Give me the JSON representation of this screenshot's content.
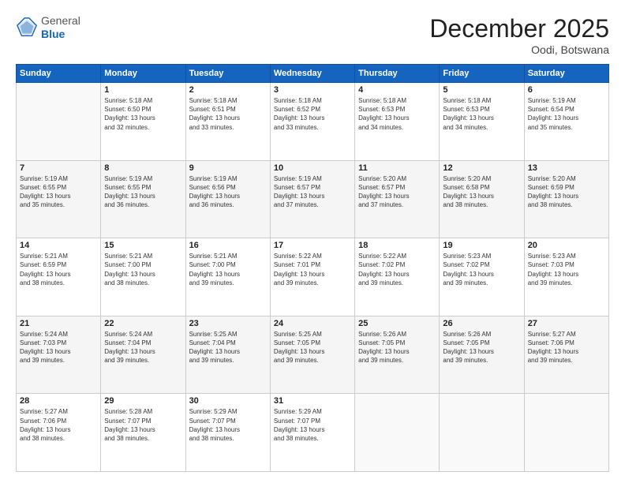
{
  "header": {
    "logo_line1": "General",
    "logo_line2": "Blue",
    "month_year": "December 2025",
    "location": "Oodi, Botswana"
  },
  "days_of_week": [
    "Sunday",
    "Monday",
    "Tuesday",
    "Wednesday",
    "Thursday",
    "Friday",
    "Saturday"
  ],
  "weeks": [
    [
      {
        "day": "",
        "info": ""
      },
      {
        "day": "1",
        "info": "Sunrise: 5:18 AM\nSunset: 6:50 PM\nDaylight: 13 hours\nand 32 minutes."
      },
      {
        "day": "2",
        "info": "Sunrise: 5:18 AM\nSunset: 6:51 PM\nDaylight: 13 hours\nand 33 minutes."
      },
      {
        "day": "3",
        "info": "Sunrise: 5:18 AM\nSunset: 6:52 PM\nDaylight: 13 hours\nand 33 minutes."
      },
      {
        "day": "4",
        "info": "Sunrise: 5:18 AM\nSunset: 6:53 PM\nDaylight: 13 hours\nand 34 minutes."
      },
      {
        "day": "5",
        "info": "Sunrise: 5:18 AM\nSunset: 6:53 PM\nDaylight: 13 hours\nand 34 minutes."
      },
      {
        "day": "6",
        "info": "Sunrise: 5:19 AM\nSunset: 6:54 PM\nDaylight: 13 hours\nand 35 minutes."
      }
    ],
    [
      {
        "day": "7",
        "info": "Sunrise: 5:19 AM\nSunset: 6:55 PM\nDaylight: 13 hours\nand 35 minutes."
      },
      {
        "day": "8",
        "info": "Sunrise: 5:19 AM\nSunset: 6:55 PM\nDaylight: 13 hours\nand 36 minutes."
      },
      {
        "day": "9",
        "info": "Sunrise: 5:19 AM\nSunset: 6:56 PM\nDaylight: 13 hours\nand 36 minutes."
      },
      {
        "day": "10",
        "info": "Sunrise: 5:19 AM\nSunset: 6:57 PM\nDaylight: 13 hours\nand 37 minutes."
      },
      {
        "day": "11",
        "info": "Sunrise: 5:20 AM\nSunset: 6:57 PM\nDaylight: 13 hours\nand 37 minutes."
      },
      {
        "day": "12",
        "info": "Sunrise: 5:20 AM\nSunset: 6:58 PM\nDaylight: 13 hours\nand 38 minutes."
      },
      {
        "day": "13",
        "info": "Sunrise: 5:20 AM\nSunset: 6:59 PM\nDaylight: 13 hours\nand 38 minutes."
      }
    ],
    [
      {
        "day": "14",
        "info": "Sunrise: 5:21 AM\nSunset: 6:59 PM\nDaylight: 13 hours\nand 38 minutes."
      },
      {
        "day": "15",
        "info": "Sunrise: 5:21 AM\nSunset: 7:00 PM\nDaylight: 13 hours\nand 38 minutes."
      },
      {
        "day": "16",
        "info": "Sunrise: 5:21 AM\nSunset: 7:00 PM\nDaylight: 13 hours\nand 39 minutes."
      },
      {
        "day": "17",
        "info": "Sunrise: 5:22 AM\nSunset: 7:01 PM\nDaylight: 13 hours\nand 39 minutes."
      },
      {
        "day": "18",
        "info": "Sunrise: 5:22 AM\nSunset: 7:02 PM\nDaylight: 13 hours\nand 39 minutes."
      },
      {
        "day": "19",
        "info": "Sunrise: 5:23 AM\nSunset: 7:02 PM\nDaylight: 13 hours\nand 39 minutes."
      },
      {
        "day": "20",
        "info": "Sunrise: 5:23 AM\nSunset: 7:03 PM\nDaylight: 13 hours\nand 39 minutes."
      }
    ],
    [
      {
        "day": "21",
        "info": "Sunrise: 5:24 AM\nSunset: 7:03 PM\nDaylight: 13 hours\nand 39 minutes."
      },
      {
        "day": "22",
        "info": "Sunrise: 5:24 AM\nSunset: 7:04 PM\nDaylight: 13 hours\nand 39 minutes."
      },
      {
        "day": "23",
        "info": "Sunrise: 5:25 AM\nSunset: 7:04 PM\nDaylight: 13 hours\nand 39 minutes."
      },
      {
        "day": "24",
        "info": "Sunrise: 5:25 AM\nSunset: 7:05 PM\nDaylight: 13 hours\nand 39 minutes."
      },
      {
        "day": "25",
        "info": "Sunrise: 5:26 AM\nSunset: 7:05 PM\nDaylight: 13 hours\nand 39 minutes."
      },
      {
        "day": "26",
        "info": "Sunrise: 5:26 AM\nSunset: 7:05 PM\nDaylight: 13 hours\nand 39 minutes."
      },
      {
        "day": "27",
        "info": "Sunrise: 5:27 AM\nSunset: 7:06 PM\nDaylight: 13 hours\nand 39 minutes."
      }
    ],
    [
      {
        "day": "28",
        "info": "Sunrise: 5:27 AM\nSunset: 7:06 PM\nDaylight: 13 hours\nand 38 minutes."
      },
      {
        "day": "29",
        "info": "Sunrise: 5:28 AM\nSunset: 7:07 PM\nDaylight: 13 hours\nand 38 minutes."
      },
      {
        "day": "30",
        "info": "Sunrise: 5:29 AM\nSunset: 7:07 PM\nDaylight: 13 hours\nand 38 minutes."
      },
      {
        "day": "31",
        "info": "Sunrise: 5:29 AM\nSunset: 7:07 PM\nDaylight: 13 hours\nand 38 minutes."
      },
      {
        "day": "",
        "info": ""
      },
      {
        "day": "",
        "info": ""
      },
      {
        "day": "",
        "info": ""
      }
    ]
  ]
}
